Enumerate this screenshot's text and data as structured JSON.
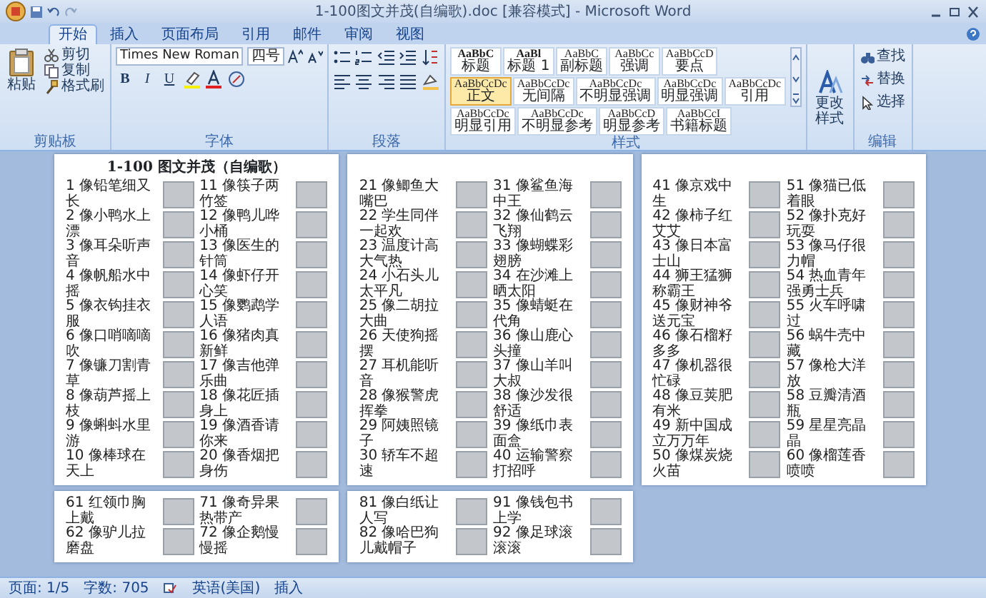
{
  "window": {
    "title": "1-100图文并茂(自编歌).doc [兼容模式] - Microsoft Word"
  },
  "ribbon_tabs": [
    {
      "label": "开始",
      "selected": true
    },
    {
      "label": "插入",
      "selected": false
    },
    {
      "label": "页面布局",
      "selected": false
    },
    {
      "label": "引用",
      "selected": false
    },
    {
      "label": "邮件",
      "selected": false
    },
    {
      "label": "审阅",
      "selected": false
    },
    {
      "label": "视图",
      "selected": false
    }
  ],
  "clipboard": {
    "label": "剪贴板",
    "paste": "粘贴",
    "items": [
      "剪切",
      "复制",
      "格式刷"
    ]
  },
  "font": {
    "label": "字体",
    "font_name": "Times New Roman",
    "font_size": "四号",
    "format_buttons": [
      "B",
      "I",
      "U"
    ]
  },
  "paragraph": {
    "label": "段落"
  },
  "styles": {
    "label": "样式",
    "items": [
      {
        "preview": "AaBbC",
        "name": "标题",
        "selected": false
      },
      {
        "preview": "AaBl",
        "name": "标题 1",
        "selected": false
      },
      {
        "preview": "AaBbC",
        "name": "副标题",
        "selected": false
      },
      {
        "preview": "AaBbCc",
        "name": "强调",
        "selected": false
      },
      {
        "preview": "AaBbCcD",
        "name": "要点",
        "selected": false
      },
      {
        "preview": "AaBbCcDc",
        "name": "正文",
        "selected": true
      },
      {
        "preview": "AaBbCcDc",
        "name": "无间隔",
        "selected": false
      },
      {
        "preview": "AaBbCcDc",
        "name": "不明显强调",
        "selected": false
      },
      {
        "preview": "AaBbCcDc",
        "name": "明显强调",
        "selected": false
      },
      {
        "preview": "AaBbCcDc",
        "name": "引用",
        "selected": false
      },
      {
        "preview": "AaBbCcDc",
        "name": "明显引用",
        "selected": false
      },
      {
        "preview": "AaBbCcDc",
        "name": "不明显参考",
        "selected": false
      },
      {
        "preview": "AaBbCcD",
        "name": "明显参考",
        "selected": false
      },
      {
        "preview": "AaBbCcI",
        "name": "书籍标题",
        "selected": false
      }
    ]
  },
  "change_styles": "更改样式",
  "editing": {
    "label": "编辑",
    "items": [
      "查找",
      "替换",
      "选择"
    ]
  },
  "pages": [
    {
      "title": "1-100 图文并茂（自编歌）",
      "columns": [
        [
          "1 像铅笔细又长",
          "2 像小鸭水上漂",
          "3 像耳朵听声音",
          "4 像帆船水中摇",
          "5 像衣钩挂衣服",
          "6 像口哨嘀嘀吹",
          "7 像镰刀割青草",
          "8 像葫芦摇上枝",
          "9 像蝌蚪水里游",
          "10 像棒球在天上"
        ],
        [
          "11 像筷子两竹签",
          "12 像鸭儿哗小桶",
          "13 像医生的针筒",
          "14 像虾仔开心笑",
          "15 像鹦鹉学人语",
          "16 像猪肉真新鲜",
          "17 像吉他弹乐曲",
          "18 像花匠插身上",
          "19 像酒香请你来",
          "20 像香烟把身伤"
        ]
      ]
    },
    {
      "columns": [
        [
          "21 像鲫鱼大嘴巴",
          "22 学生同伴一起欢",
          "23 温度计高大气热",
          "24 小石头儿太平凡",
          "25 像二胡拉大曲",
          "26 天使狗摇摆",
          "27 耳机能听音",
          "28 像猴警虎挥拳",
          "29 阿姨照镜子",
          "30 轿车不超速"
        ],
        [
          "31 像鲨鱼海中王",
          "32 像仙鹤云飞翔",
          "33 像蝴蝶彩翅膀",
          "34 在沙滩上晒太阳",
          "35 像蜻蜓在代角",
          "36 像山鹿心头撞",
          "37 像山羊叫大叔",
          "38 像沙发很舒适",
          "39 像纸巾表面盒",
          "40 运输警察打招呼"
        ]
      ]
    },
    {
      "columns": [
        [
          "41 像京戏中生",
          "42 像柿子红艾艾",
          "43 像日本富士山",
          "44 狮王猛狮称霸王",
          "45 像财神爷送元宝",
          "46 像石榴籽多多",
          "47 像机器很忙碌",
          "48 像豆荚肥有米",
          "49 新中国成立万万年",
          "50 像煤炭烧火苗"
        ],
        [
          "51 像猫已低着眼",
          "52 像扑克好玩耍",
          "53 像马仔很力帽",
          "54 热血青年强勇士兵",
          "55 火车呼啸过",
          "56 蜗牛壳中藏",
          "57 像枪大洋放",
          "58 豆瓣清酒瓶",
          "59 星星亮晶晶",
          "60 像榴莲香喷喷"
        ]
      ]
    },
    {
      "columns": [
        [
          "61 红领巾胸上戴",
          "62 像驴儿拉磨盘"
        ],
        [
          "71 像奇异果热带产",
          "72 像企鹅慢慢摇"
        ]
      ]
    },
    {
      "columns": [
        [
          "81 像白纸让人写",
          "82 像哈巴狗儿戴帽子"
        ],
        [
          "91 像钱包书上学",
          "92 像足球滚滚滚"
        ]
      ]
    }
  ],
  "status_bar": [
    "页面: 1/5",
    "字数: 705",
    "英语(美国)",
    "插入"
  ]
}
